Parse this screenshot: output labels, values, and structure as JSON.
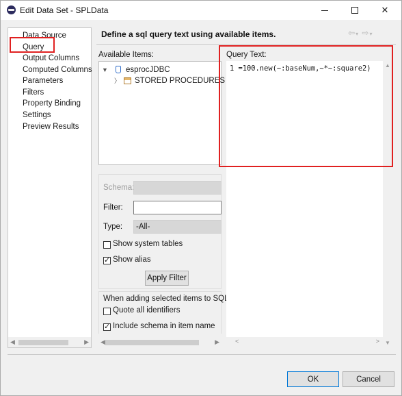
{
  "window": {
    "title": "Edit Data Set - SPLData"
  },
  "nav": {
    "items": [
      {
        "label": "Data Source"
      },
      {
        "label": "Query"
      },
      {
        "label": "Output Columns"
      },
      {
        "label": "Computed Columns"
      },
      {
        "label": "Parameters"
      },
      {
        "label": "Filters"
      },
      {
        "label": "Property Binding"
      },
      {
        "label": "Settings"
      },
      {
        "label": "Preview Results"
      }
    ],
    "selected": "Query"
  },
  "header": {
    "title": "Define a sql query text using available items."
  },
  "available": {
    "label": "Available Items:",
    "tree": [
      {
        "label": "esprocJDBC",
        "icon": "database-icon",
        "expanded": true
      },
      {
        "label": "STORED PROCEDURES",
        "icon": "table-icon",
        "expanded": false
      }
    ]
  },
  "filter": {
    "schema_label": "Schema:",
    "filter_label": "Filter:",
    "filter_value": "",
    "type_label": "Type:",
    "type_value": "-All-",
    "show_system_tables": {
      "label": "Show system tables",
      "checked": false
    },
    "show_alias": {
      "label": "Show alias",
      "checked": true
    },
    "apply_label": "Apply Filter"
  },
  "adding": {
    "heading": "When adding selected items to SQL",
    "quote_all": {
      "label": "Quote all identifiers",
      "checked": false
    },
    "include_schema": {
      "label": "Include schema in item name",
      "checked": true
    }
  },
  "query": {
    "label": "Query Text:",
    "lines": [
      {
        "number": "1",
        "text": "=100.new(~:baseNum,~*~:square2)"
      }
    ]
  },
  "buttons": {
    "ok": "OK",
    "cancel": "Cancel"
  },
  "colors": {
    "highlight": "#e02020",
    "accent": "#0078d7"
  }
}
